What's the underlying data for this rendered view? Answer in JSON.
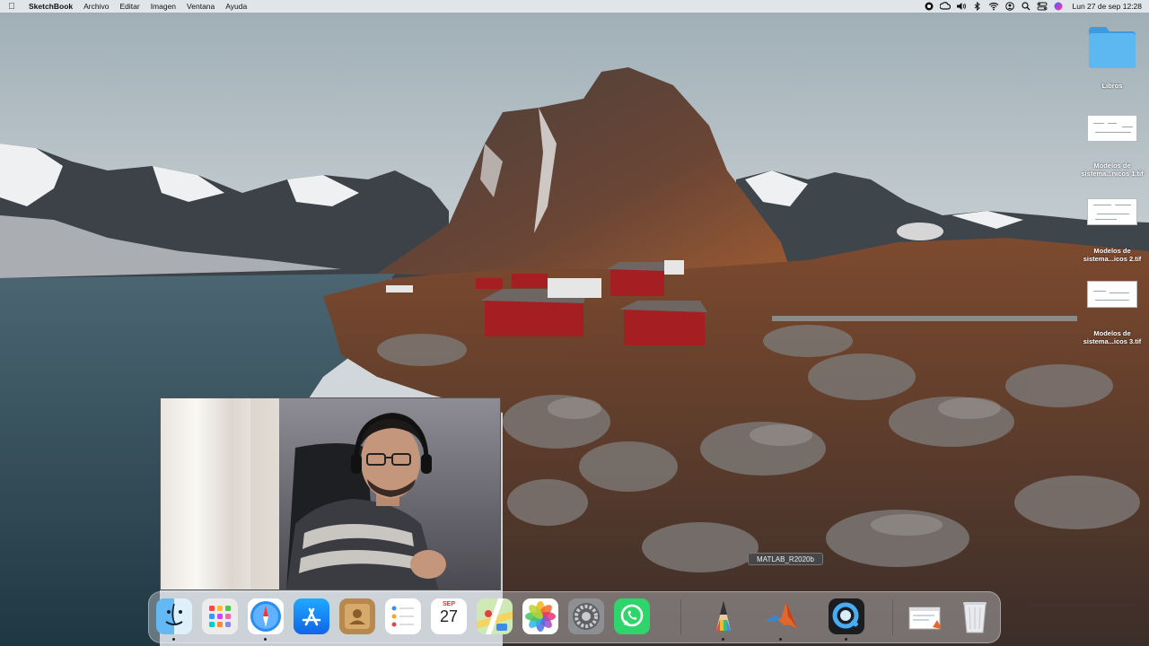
{
  "menubar": {
    "apple_icon": "apple-icon",
    "app_name": "SketchBook",
    "items": [
      "Archivo",
      "Editar",
      "Imagen",
      "Ventana",
      "Ayuda"
    ],
    "status_icons": [
      "record-icon",
      "creative-cloud-icon",
      "volume-icon",
      "bluetooth-icon",
      "wifi-icon",
      "user-icon",
      "search-icon",
      "control-center-icon",
      "siri-icon"
    ],
    "clock": "Lun 27 de sep  12:28"
  },
  "desktop": {
    "folder": {
      "label": "Libros",
      "color": "#4aa8e8"
    },
    "files": [
      {
        "label_line1": "Modelos de",
        "label_line2": "sistema...nicos 1.tif"
      },
      {
        "label_line1": "Modelos de",
        "label_line2": "sistema...icos 2.tif"
      },
      {
        "label_line1": "Modelos de",
        "label_line2": "sistema...icos 3.tif"
      }
    ]
  },
  "tooltip": {
    "text": "MATLAB_R2020b"
  },
  "dock": {
    "apps": [
      {
        "name": "finder",
        "icon": "finder-icon",
        "running": true
      },
      {
        "name": "launchpad",
        "icon": "launchpad-icon",
        "running": false
      },
      {
        "name": "safari",
        "icon": "safari-icon",
        "running": true
      },
      {
        "name": "app-store",
        "icon": "app-store-icon",
        "running": false
      },
      {
        "name": "contacts",
        "icon": "contacts-icon",
        "running": false
      },
      {
        "name": "reminders",
        "icon": "reminders-icon",
        "running": false
      },
      {
        "name": "calendar",
        "icon": "calendar-icon",
        "running": false,
        "month": "SEP",
        "day": "27"
      },
      {
        "name": "maps",
        "icon": "maps-icon",
        "running": false
      },
      {
        "name": "photos",
        "icon": "photos-icon",
        "running": false
      },
      {
        "name": "system-preferences",
        "icon": "system-preferences-icon",
        "running": false
      },
      {
        "name": "whatsapp",
        "icon": "whatsapp-icon",
        "running": false
      },
      {
        "name": "sketchbook",
        "icon": "sketchbook-pencil-icon",
        "running": true
      },
      {
        "name": "matlab",
        "icon": "matlab-icon",
        "running": true
      },
      {
        "name": "quicktime",
        "icon": "quicktime-icon",
        "running": true
      },
      {
        "name": "recent-document",
        "icon": "document-preview-icon",
        "running": false
      },
      {
        "name": "trash",
        "icon": "trash-icon",
        "running": false
      }
    ]
  },
  "colors": {
    "menubar_bg": "#eef1f4",
    "sky": "#c9d2d6",
    "water": "#2f4a56",
    "rock_orange": "#a0522d",
    "house_red": "#a41e22"
  }
}
